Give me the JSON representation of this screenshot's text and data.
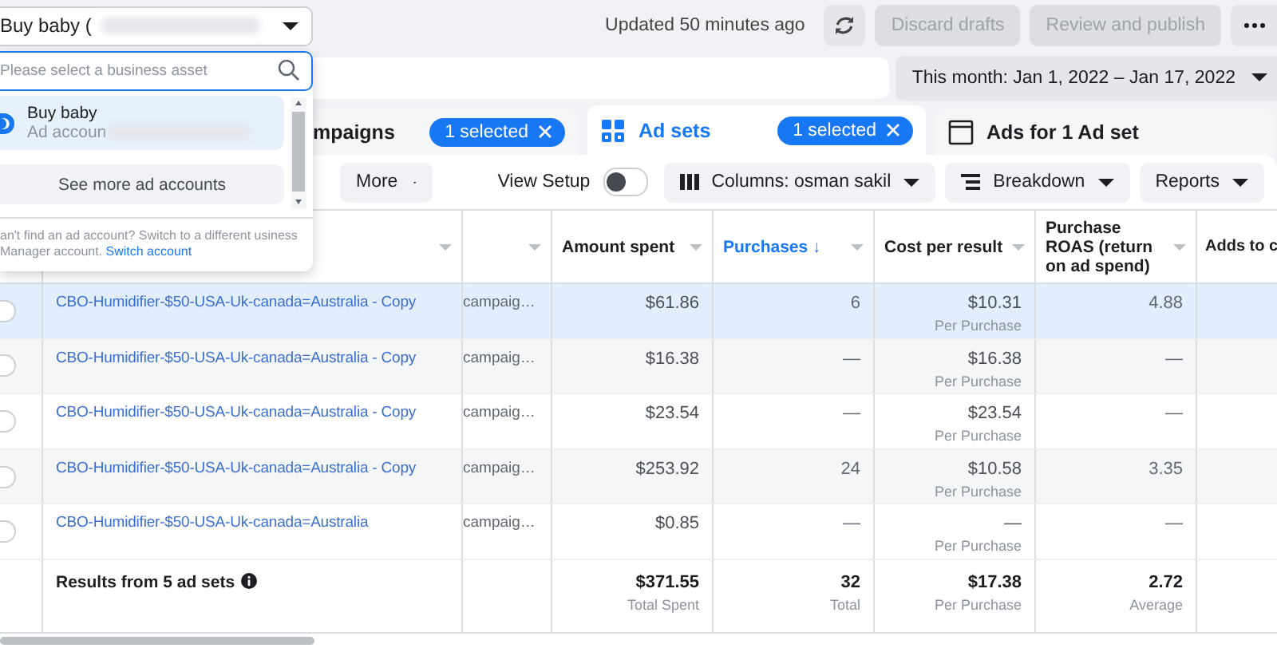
{
  "account_selector": {
    "label": "Buy baby ("
  },
  "updated": "Updated 50 minutes ago",
  "actions": [
    {
      "label": "Discard drafts",
      "disabled": true
    },
    {
      "label": "Review and publish",
      "disabled": true
    }
  ],
  "date_range": "This month: Jan 1, 2022 – Jan 17, 2022",
  "tabs": [
    {
      "kind": "campaigns",
      "label": "mpaigns",
      "badge": "1 selected",
      "selected": false
    },
    {
      "kind": "adsets",
      "label": "Ad sets",
      "badge": "1 selected",
      "selected": true
    },
    {
      "kind": "ads",
      "label": "Ads for 1 Ad set",
      "selected": false
    }
  ],
  "toolbar": {
    "more": "More",
    "view_setup": {
      "label": "View Setup",
      "on": false
    },
    "buttons": [
      {
        "kind": "columns",
        "label": "Columns: osman sakil"
      },
      {
        "kind": "breakdown",
        "label": "Breakdown"
      },
      {
        "kind": "reports",
        "label": "Reports"
      }
    ]
  },
  "table": {
    "columns": [
      {
        "label": "Amount spent",
        "sorted": false
      },
      {
        "label": "Purchases ↓",
        "sorted": true
      },
      {
        "label": "Cost per result",
        "sorted": false
      },
      {
        "label": "Purchase ROAS (return on ad spend)",
        "sorted": false
      },
      {
        "label": "Adds to c",
        "sorted": false
      }
    ],
    "rows": [
      {
        "selected": true,
        "checked": false,
        "name": "CBO-Humidifier-$50-USA-Uk-canada=Australia - Copy",
        "column_3": "campaig…",
        "amount_spent": "$61.86",
        "purchases": "6",
        "cost": "$10.31",
        "cost_note": "Per Purchase",
        "roas": "4.88"
      },
      {
        "selected": false,
        "checked": false,
        "name": "CBO-Humidifier-$50-USA-Uk-canada=Australia - Copy",
        "column_3": "campaig…",
        "amount_spent": "$16.38",
        "purchases": "—",
        "cost": "$16.38",
        "cost_note": "Per Purchase",
        "roas": "—"
      },
      {
        "selected": false,
        "checked": false,
        "name": "CBO-Humidifier-$50-USA-Uk-canada=Australia - Copy",
        "column_3": "campaig…",
        "amount_spent": "$23.54",
        "purchases": "—",
        "cost": "$23.54",
        "cost_note": "Per Purchase",
        "roas": "—"
      },
      {
        "selected": false,
        "checked": false,
        "name": "CBO-Humidifier-$50-USA-Uk-canada=Australia - Copy",
        "column_3": "campaig…",
        "amount_spent": "$253.92",
        "purchases": "24",
        "cost": "$10.58",
        "cost_note": "Per Purchase",
        "roas": "3.35"
      },
      {
        "selected": false,
        "checked": false,
        "name": "CBO-Humidifier-$50-USA-Uk-canada=Australia",
        "column_3": "campaig…",
        "amount_spent": "$0.85",
        "purchases": "—",
        "cost": "—",
        "cost_note": "Per Purchase",
        "roas": "—"
      }
    ],
    "summary": {
      "label": "Results from 5 ad sets",
      "cells": [
        {
          "value": "$371.55",
          "note": "Total Spent"
        },
        {
          "value": "32",
          "note": "Total"
        },
        {
          "value": "$17.38",
          "note": "Per Purchase"
        },
        {
          "value": "2.72",
          "note": "Average"
        }
      ]
    }
  },
  "dropdown": {
    "placeholder": "Please select a business asset",
    "items": [
      {
        "name": "Buy baby",
        "detail": "Ad accoun",
        "selected": true
      }
    ],
    "more_button": "See more ad accounts",
    "help": "an't find an ad account? Switch to a different usiness Manager account.",
    "link": "Switch account"
  }
}
